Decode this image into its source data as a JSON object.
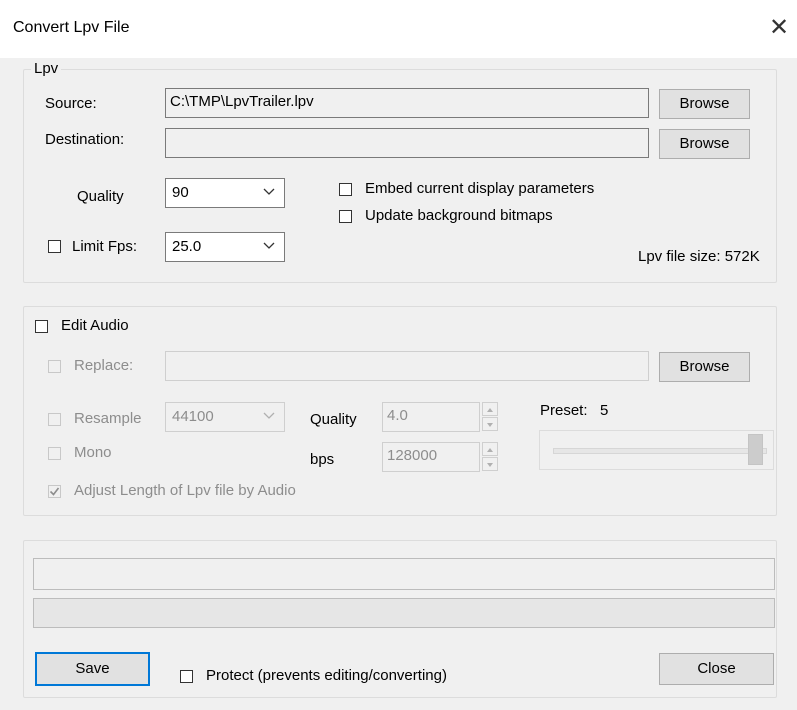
{
  "window": {
    "title": "Convert Lpv File",
    "close_glyph": "✕"
  },
  "lpv_group": {
    "label": "Lpv",
    "source_label": "Source:",
    "source_value": "C:\\TMP\\LpvTrailer.lpv",
    "destination_label": "Destination:",
    "destination_value": "",
    "browse_label": "Browse",
    "quality_label": "Quality",
    "quality_value": "90",
    "limit_fps_label": "Limit Fps:",
    "limit_fps_value": "25.0",
    "embed_label": "Embed current display parameters",
    "update_bg_label": "Update background bitmaps",
    "file_size_text": "Lpv file size: 572K"
  },
  "audio_group": {
    "edit_audio_label": "Edit Audio",
    "replace_label": "Replace:",
    "replace_value": "",
    "browse_label": "Browse",
    "resample_label": "Resample",
    "resample_value": "44100",
    "quality_label": "Quality",
    "quality_value": "4.0",
    "bps_label": "bps",
    "bps_value": "128000",
    "mono_label": "Mono",
    "adjust_label": "Adjust Length of Lpv file by Audio",
    "preset_label": "Preset:",
    "preset_value": "5"
  },
  "bottom": {
    "save_label": "Save",
    "protect_label": "Protect (prevents editing/converting)",
    "close_label": "Close"
  },
  "colors": {
    "focus": "#0078d7",
    "disabled_text": "#8d8d8d"
  }
}
